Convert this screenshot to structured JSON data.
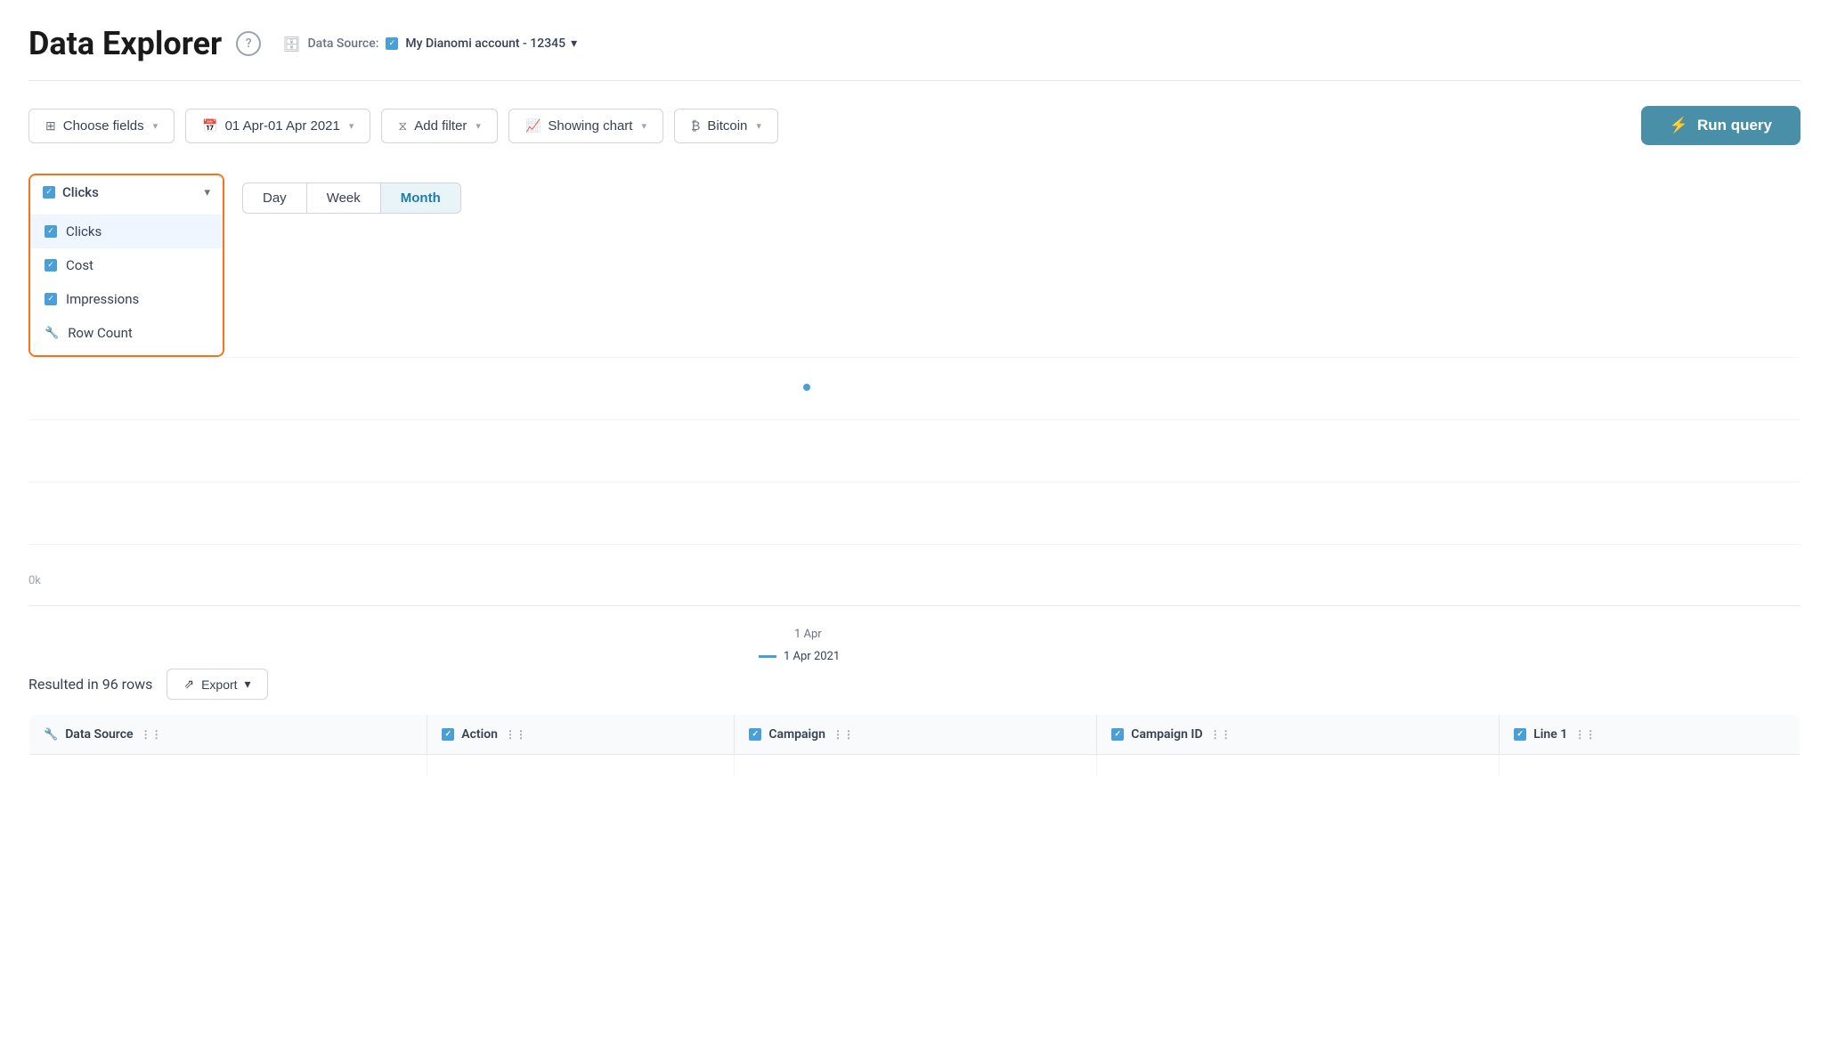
{
  "header": {
    "title": "Data Explorer",
    "help_label": "?",
    "datasource_label": "Data Source:",
    "datasource_value": "My Dianomi account - 12345",
    "datasource_dropdown": "▾"
  },
  "toolbar": {
    "choose_fields": "Choose fields",
    "date_range": "01 Apr-01 Apr 2021",
    "add_filter": "Add filter",
    "showing_chart": "Showing chart",
    "bitcoin": "Bitcoin",
    "run_query": "Run query"
  },
  "chart": {
    "field_selected": "Clicks",
    "dropdown_items": [
      {
        "label": "Clicks",
        "checked": true
      },
      {
        "label": "Cost",
        "checked": true
      },
      {
        "label": "Impressions",
        "checked": true
      },
      {
        "label": "Row Count",
        "checked": false
      }
    ],
    "period_tabs": [
      {
        "label": "Day",
        "active": false
      },
      {
        "label": "Week",
        "active": false
      },
      {
        "label": "Month",
        "active": true
      }
    ],
    "y_axis_label": "0k",
    "x_axis_date": "1 Apr",
    "legend_label": "1 Apr 2021"
  },
  "results": {
    "count_text": "Resulted in 96 rows",
    "export_label": "Export"
  },
  "table": {
    "columns": [
      {
        "label": "Data Source",
        "icon": "wrench",
        "has_checkbox": false
      },
      {
        "label": "Action",
        "icon": null,
        "has_checkbox": true
      },
      {
        "label": "Campaign",
        "icon": null,
        "has_checkbox": true
      },
      {
        "label": "Campaign ID",
        "icon": null,
        "has_checkbox": true
      },
      {
        "label": "Line 1",
        "icon": null,
        "has_checkbox": true
      }
    ]
  }
}
